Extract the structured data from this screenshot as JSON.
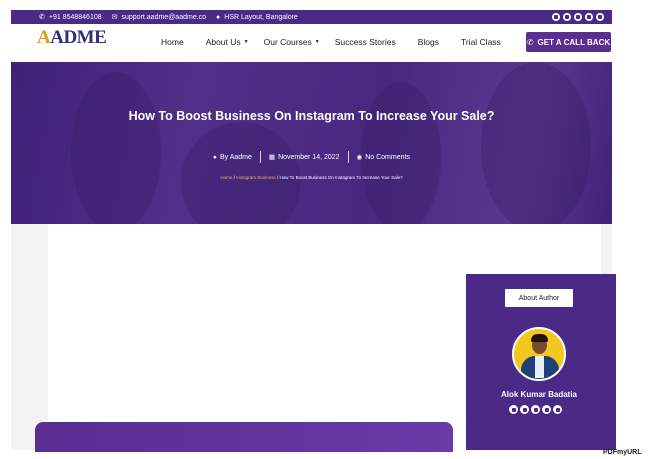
{
  "topbar": {
    "phone": "+91 8548846108",
    "email": "support.aadme@aadme.co",
    "location": "HSR Layout, Bangalore",
    "icons": [
      "phone-icon",
      "envelope-icon",
      "map-pin-icon"
    ],
    "socials": [
      "facebook-icon",
      "instagram-icon",
      "youtube-icon",
      "linkedin-icon",
      "twitter-icon"
    ]
  },
  "header": {
    "logo_text": "ADME",
    "logo_letter": "A",
    "logo_tagline": "",
    "nav": [
      {
        "label": "Home",
        "dropdown": false
      },
      {
        "label": "About Us",
        "dropdown": true
      },
      {
        "label": "Our Courses",
        "dropdown": true
      },
      {
        "label": "Success Stories",
        "dropdown": false
      },
      {
        "label": "Blogs",
        "dropdown": false
      },
      {
        "label": "Trial Class",
        "dropdown": false
      }
    ],
    "cta_label": "GET A CALL BACK"
  },
  "hero": {
    "title": "How To Boost Business On Instagram To Increase Your Sale?",
    "author": "By Aadme",
    "date": "November 14, 2022",
    "comments": "No Comments",
    "breadcrumb": {
      "home": "Home",
      "separator": " / ",
      "category": "Instagram Business",
      "current": "How To Boost Business On Instagram To Increase Your Sale?"
    }
  },
  "sidebar": {
    "about_label": "About Author",
    "author_name": "Alok Kumar Badatia",
    "socials": [
      "facebook-icon",
      "instagram-icon",
      "linkedin-icon",
      "twitter-icon",
      "youtube-icon"
    ]
  },
  "watermark": "PDFmyURL",
  "colors": {
    "brand_purple": "#4a2a86",
    "cta_purple": "#5b2d91",
    "breadcrumb_highlight": "#f0b24a",
    "avatar_bg": "#f2c81f"
  }
}
